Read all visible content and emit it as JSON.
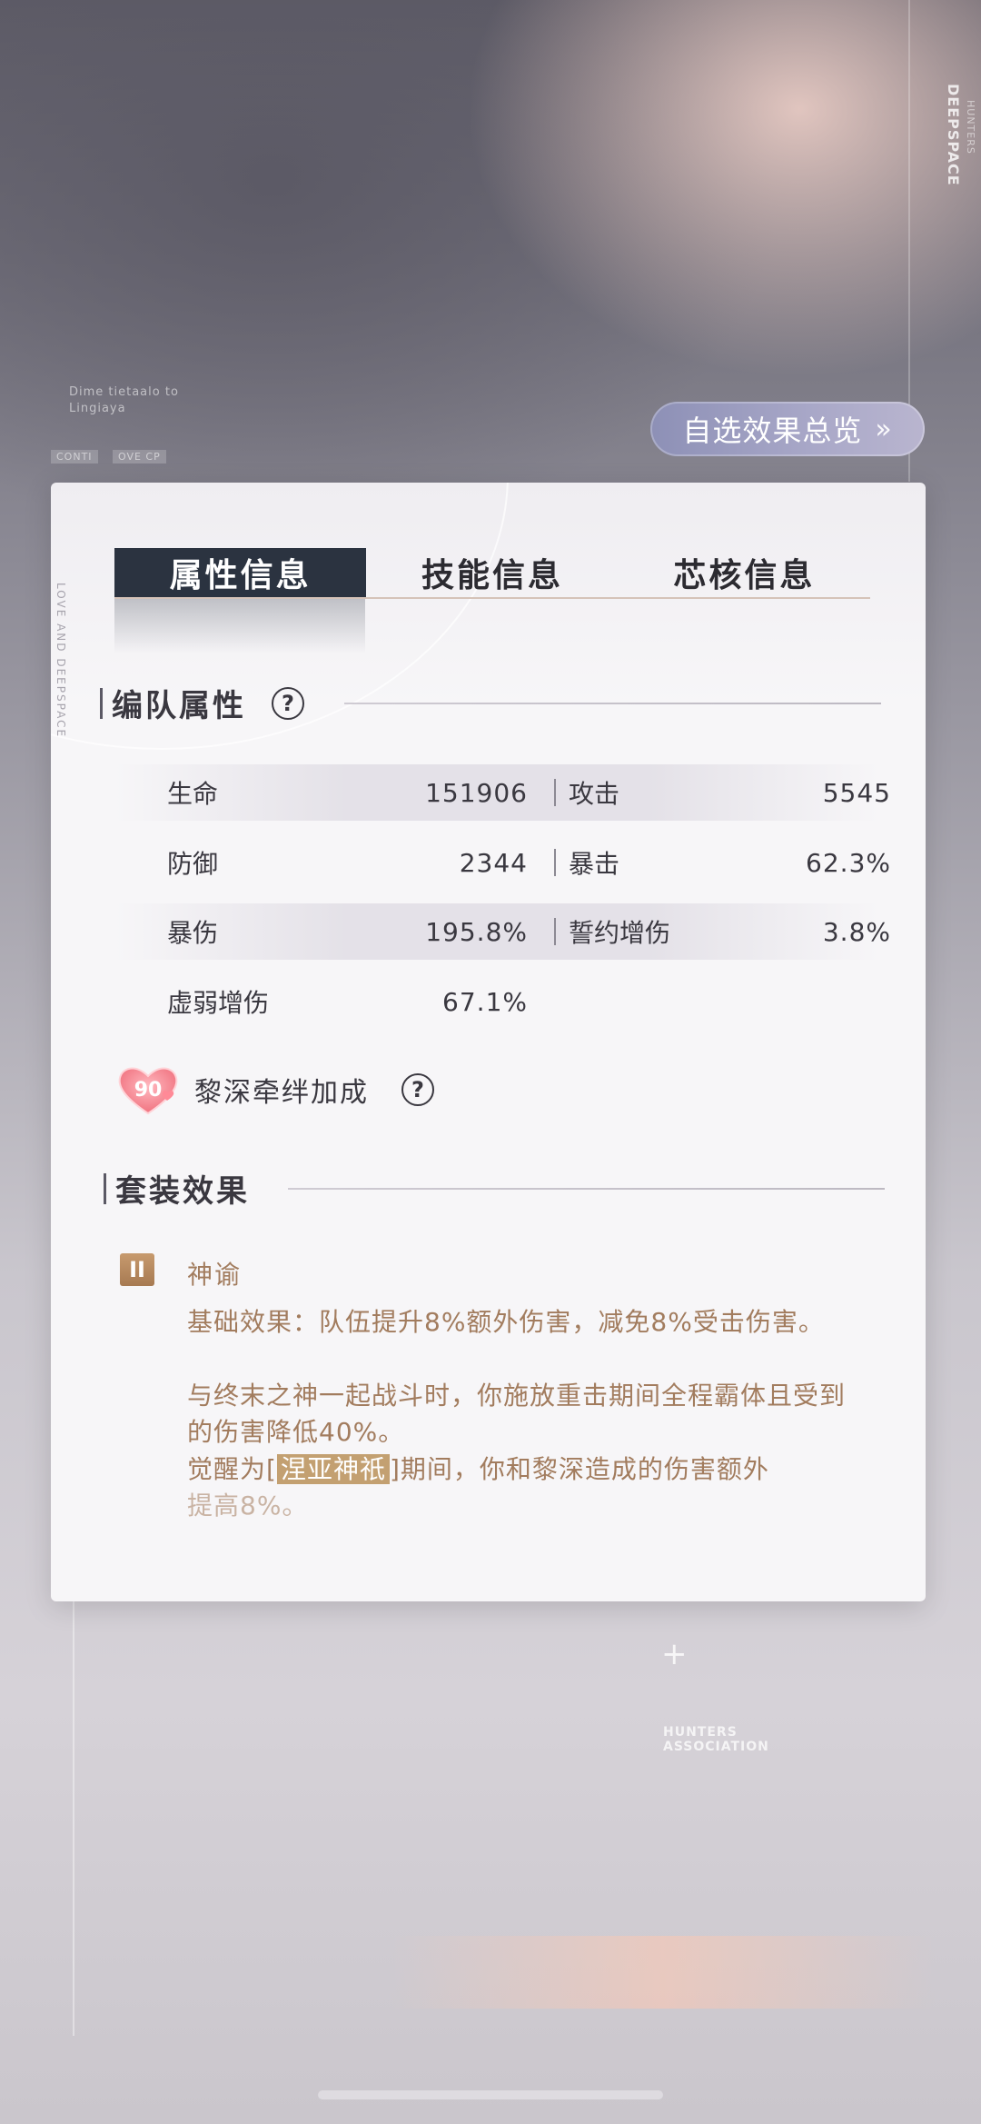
{
  "background": {
    "brand_vertical": "DEEPSPACE",
    "brand_sub": "HUNTERS",
    "small_text_1": "Dime tietaalo to",
    "small_text_2": "Lingiaya",
    "tag_1": "CONTI",
    "tag_2": "OVE CP",
    "association": "HUNTERS ASSOCIATION",
    "plus_icon": "plus-icon"
  },
  "overview_button": {
    "label": "自选效果总览",
    "icon": "double-chevron-right-icon"
  },
  "card": {
    "side_text": "LOVE AND DEEPSPACE",
    "tabs": [
      {
        "label": "属性信息",
        "active": true
      },
      {
        "label": "技能信息",
        "active": false
      },
      {
        "label": "芯核信息",
        "active": false
      }
    ],
    "team_attrs": {
      "title": "编队属性",
      "help_icon": "help-circle-icon",
      "rows": [
        {
          "left_label": "生命",
          "left_value": "151906",
          "right_label": "攻击",
          "right_value": "5545"
        },
        {
          "left_label": "防御",
          "left_value": "2344",
          "right_label": "暴击",
          "right_value": "62.3%"
        },
        {
          "left_label": "暴伤",
          "left_value": "195.8%",
          "right_label": "誓约增伤",
          "right_value": "3.8%"
        },
        {
          "left_label": "虚弱增伤",
          "left_value": "67.1%",
          "right_label": "",
          "right_value": ""
        }
      ]
    },
    "bond": {
      "level": "90",
      "label": "黎深牵绊加成",
      "icon": "heart-icon",
      "help_icon": "help-circle-icon"
    },
    "set_effect": {
      "title": "套装效果",
      "badge": "II",
      "name": "神谕",
      "line1": "基础效果：队伍提升8%额外伤害，减免8%受击伤害。",
      "line2": "与终末之神一起战斗时，你施放重击期间全程霸体且受到的伤害降低40%。",
      "line3_pre": "觉醒为[",
      "line3_hl": "涅亚神祇",
      "line3_post": "]期间，你和黎深造成的伤害额外",
      "line4": "提高8%。"
    },
    "colors": {
      "accent": "#a27c5e",
      "tab_active": "#2b3340",
      "button": "#9b9cbf"
    }
  }
}
